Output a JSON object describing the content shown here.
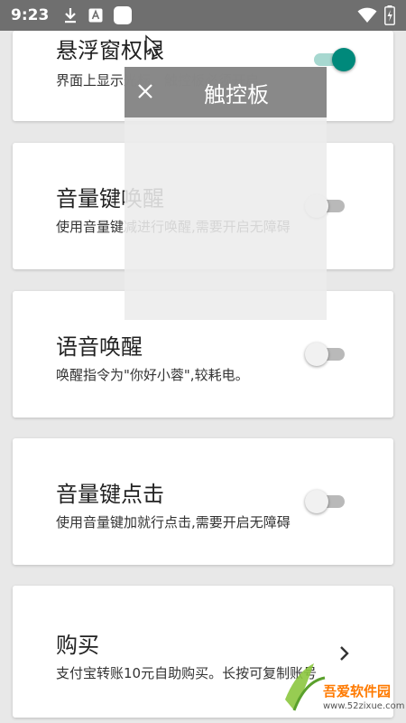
{
  "status_bar": {
    "time": "9:23",
    "icons": [
      "download-icon",
      "translate-icon",
      "app-icon",
      "wifi-icon",
      "battery-charging-icon"
    ]
  },
  "settings": [
    {
      "title": "悬浮窗权限",
      "desc": "界面上显示光标、触控板必须开启。",
      "control": "switch",
      "on": true
    },
    {
      "title": "音量键唤醒",
      "desc": "使用音量键减进行唤醒,需要开启无障碍",
      "control": "switch",
      "on": false
    },
    {
      "title": "语音唤醒",
      "desc": "唤醒指令为\"你好小蓉\",较耗电。",
      "control": "switch",
      "on": false
    },
    {
      "title": "音量键点击",
      "desc": "使用音量键加就行点击,需要开启无障碍",
      "control": "switch",
      "on": false
    },
    {
      "title": "购买",
      "desc": "支付宝转账10元自助购买。长按可复制账号",
      "control": "chevron"
    }
  ],
  "touchpad": {
    "title": "触控板",
    "close_icon": "close-icon"
  },
  "watermark": {
    "name": "吾爱软件园",
    "url": "www.52zixue.com"
  },
  "colors": {
    "status_bar": "#6f6f6f",
    "switch_on": "#00897b",
    "switch_on_track": "#a7d8d0",
    "switch_off_track": "#b9b9b9",
    "background": "#e8e8e8"
  }
}
